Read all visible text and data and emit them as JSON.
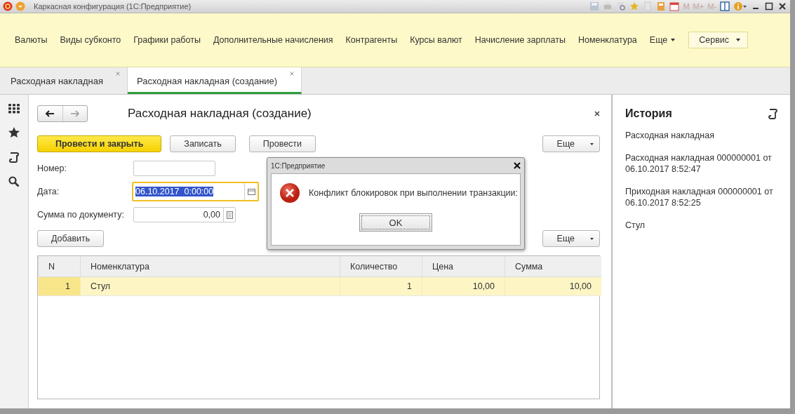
{
  "window": {
    "title": "Каркасная конфигурация  (1С:Предприятие)",
    "memory_buttons": [
      "M",
      "M+",
      "M-"
    ]
  },
  "sections": {
    "items": [
      "Валюты",
      "Виды субконто",
      "Графики работы",
      "Дополнительные начисления",
      "Контрагенты",
      "Курсы валют",
      "Начисление зарплаты",
      "Номенклатура"
    ],
    "more": "Еще",
    "service": "Сервис"
  },
  "tabs": [
    {
      "label": "Расходная накладная",
      "selected": false
    },
    {
      "label": "Расходная накладная (создание)",
      "selected": true
    }
  ],
  "form": {
    "title": "Расходная накладная (создание)",
    "buttons": [
      {
        "label": "Провести и закрыть",
        "kind": "default"
      },
      {
        "label": "Записать",
        "kind": "normal"
      },
      {
        "label": "Провести",
        "kind": "normal"
      }
    ],
    "more": "Еще",
    "fields": [
      {
        "label": "Номер:",
        "kind": "text",
        "focused": false
      },
      {
        "label": "Дата:",
        "kind": "date",
        "value": "06.10.2017  0:00:00",
        "focused": true
      },
      {
        "label": "Сумма по документу:",
        "kind": "number",
        "value": "0,00",
        "focused": false
      }
    ],
    "add_button": "Добавить",
    "table_more": "Еще"
  },
  "table": {
    "columns": [
      "N",
      "Номенклатура",
      "Количество",
      "Цена",
      "Сумма"
    ],
    "rows": [
      {
        "cells": [
          "1",
          "Стул",
          "1",
          "10,00",
          "10,00"
        ],
        "selected": true
      }
    ]
  },
  "history": {
    "title": "История",
    "items": [
      "Расходная накладная",
      "Расходная накладная 000000001 от 06.10.2017 8:52:47",
      "Приходная накладная 000000001 от 06.10.2017 8:52:25",
      "Стул"
    ]
  },
  "dialog": {
    "title": "1С:Предприятие",
    "message": "Конфликт блокировок при выполнении транзакции:",
    "button": "OK"
  }
}
